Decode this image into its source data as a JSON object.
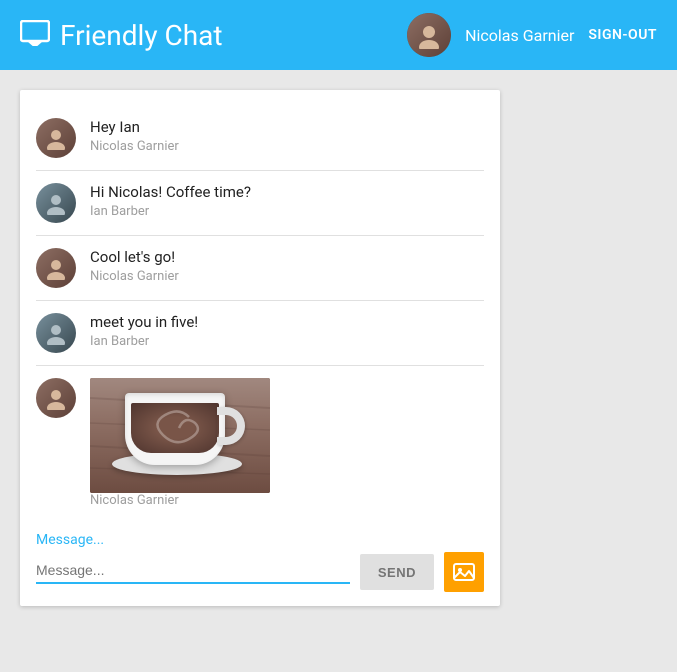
{
  "header": {
    "title": "Friendly Chat",
    "logo_icon": "💬",
    "user": {
      "name": "Nicolas Garnier"
    },
    "signout_label": "SIGN-OUT"
  },
  "chat": {
    "messages": [
      {
        "id": 1,
        "text": "Hey Ian",
        "sender": "Nicolas Garnier",
        "avatar_type": "nicolas",
        "has_image": false
      },
      {
        "id": 2,
        "text": "Hi Nicolas! Coffee time?",
        "sender": "Ian Barber",
        "avatar_type": "ian",
        "has_image": false
      },
      {
        "id": 3,
        "text": "Cool let's go!",
        "sender": "Nicolas Garnier",
        "avatar_type": "nicolas",
        "has_image": false
      },
      {
        "id": 4,
        "text": "meet you in five!",
        "sender": "Ian Barber",
        "avatar_type": "ian",
        "has_image": false
      },
      {
        "id": 5,
        "text": "",
        "sender": "Nicolas Garnier",
        "avatar_type": "nicolas",
        "has_image": true
      }
    ],
    "input": {
      "placeholder": "Message...",
      "send_label": "SEND"
    }
  }
}
